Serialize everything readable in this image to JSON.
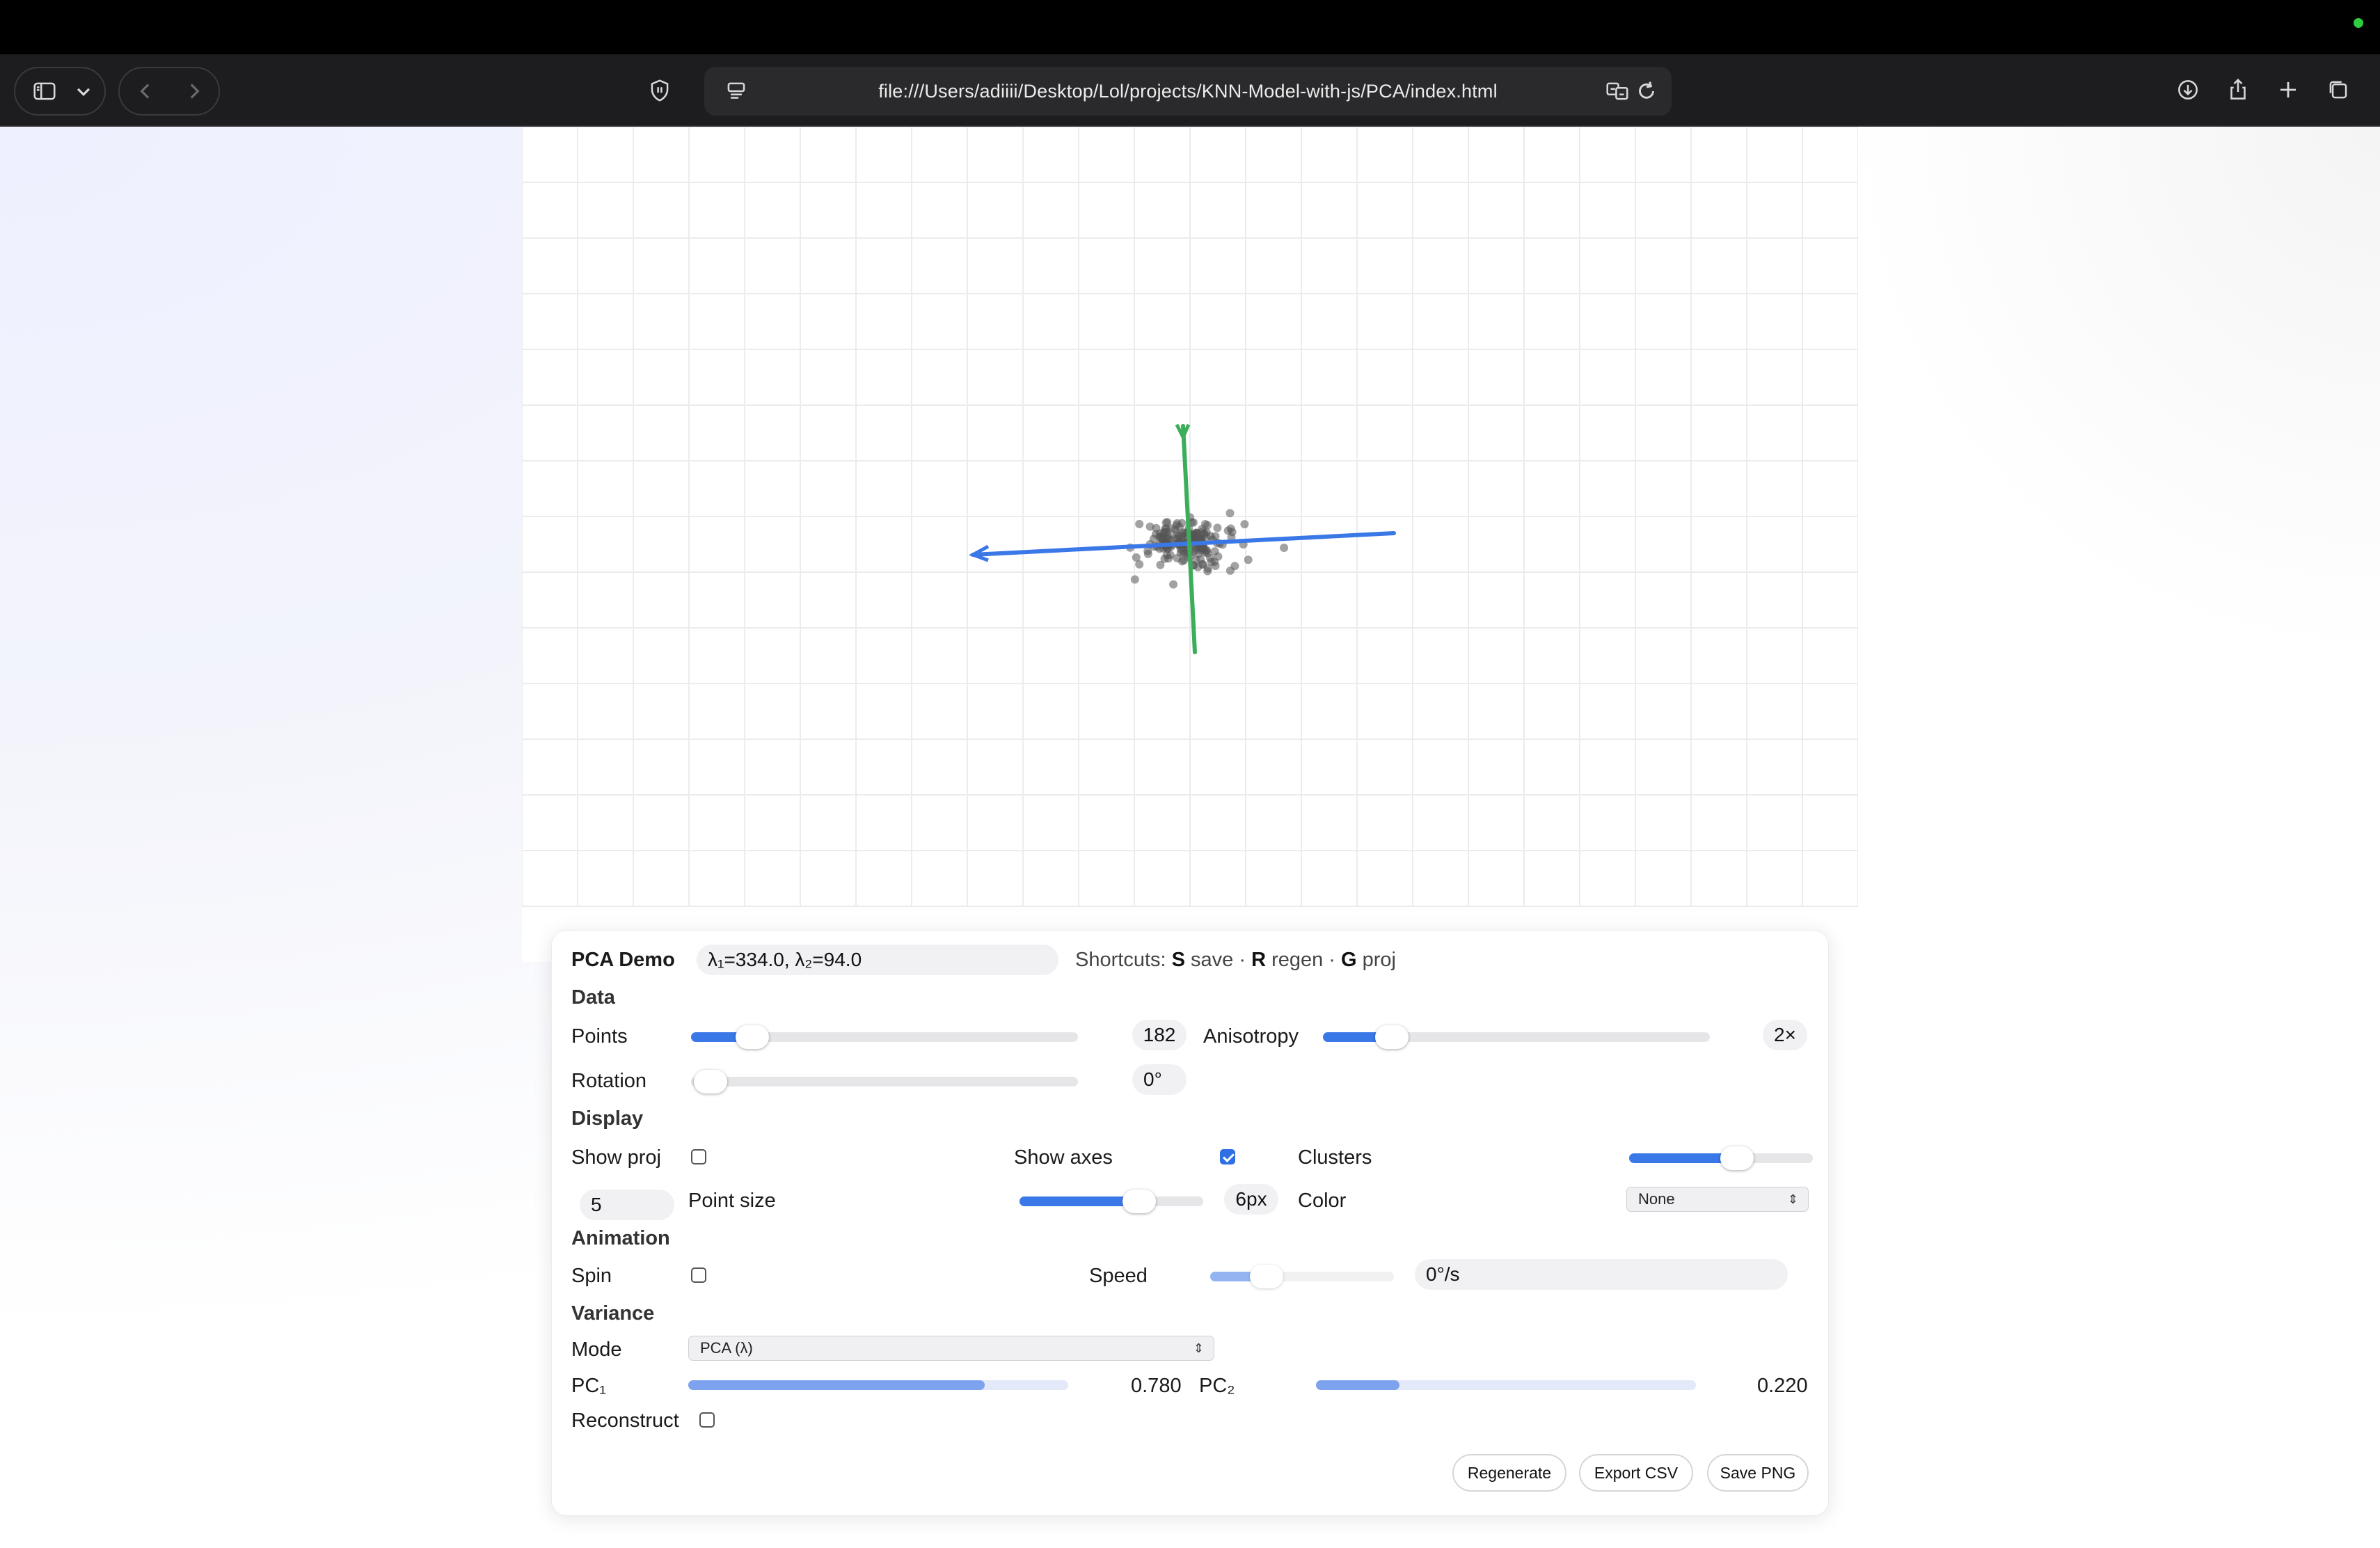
{
  "browser": {
    "url": "file:///Users/adiiii/Desktop/Lol/projects/KNN-Model-with-js/PCA/index.html"
  },
  "colors": {
    "accent": "#3b78e7",
    "pc1_axis": "#3b78e7",
    "pc2_axis": "#3cae5a",
    "points": "#555555"
  },
  "panel": {
    "title": "PCA Demo",
    "eigen_readout": "λ₁=334.0, λ₂=94.0",
    "shortcuts": {
      "prefix": "Shortcuts: ",
      "key_save": "S",
      "save": " save · ",
      "key_regen": "R",
      "regen": " regen · ",
      "key_proj": "G",
      "proj": " proj"
    },
    "data_section": {
      "heading": "Data",
      "points_label": "Points",
      "points_value": "182",
      "points_level": 0.12,
      "anisotropy_label": "Anisotropy",
      "anisotropy_value": "2×",
      "anisotropy_level": 0.14,
      "rotation_label": "Rotation",
      "rotation_value": "0°",
      "rotation_level": 0.0
    },
    "display_section": {
      "heading": "Display",
      "show_proj_label": "Show proj",
      "show_proj_checked": false,
      "show_axes_label": "Show axes",
      "show_axes_checked": true,
      "clusters_label": "Clusters",
      "clusters_level": 0.6,
      "clusters_value": "5",
      "point_size_label": "Point size",
      "point_size_value": "6px",
      "point_size_level": 0.68,
      "color_label": "Color",
      "color_selected": "None"
    },
    "animation_section": {
      "heading": "Animation",
      "spin_label": "Spin",
      "spin_checked": false,
      "speed_label": "Speed",
      "speed_value": "0°/s",
      "speed_level": 0.25
    },
    "variance_section": {
      "heading": "Variance",
      "mode_label": "Mode",
      "mode_selected": "PCA (λ)",
      "pc1_label": "PC₁",
      "pc1_value": "0.780",
      "pc1_ratio": 0.78,
      "pc2_label": "PC₂",
      "pc2_value": "0.220",
      "pc2_ratio": 0.22,
      "reconstruct_label": "Reconstruct",
      "reconstruct_checked": false
    },
    "buttons": {
      "regenerate": "Regenerate",
      "export_csv": "Export CSV",
      "save_png": "Save PNG"
    }
  }
}
